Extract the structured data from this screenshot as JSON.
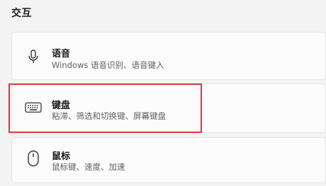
{
  "section": {
    "title": "交互"
  },
  "items": [
    {
      "title": "语音",
      "subtitle": "Windows 语音识别、语音键入",
      "icon": "microphone-icon"
    },
    {
      "title": "键盘",
      "subtitle": "粘滞、筛选和切换键、屏幕键盘",
      "icon": "keyboard-icon"
    },
    {
      "title": "鼠标",
      "subtitle": "鼠标键、速度、加速",
      "icon": "mouse-icon"
    }
  ],
  "colors": {
    "background": "#f3f3f3",
    "card": "#fbfbfb",
    "highlight": "#e0343a"
  }
}
